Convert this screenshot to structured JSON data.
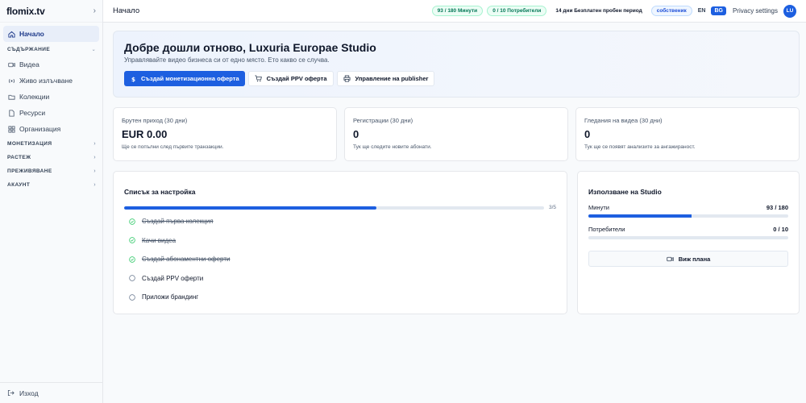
{
  "brand": {
    "logo": "flomix.tv",
    "collapse_icon": "chevron-right-icon"
  },
  "sidebar": {
    "items": [
      {
        "label": "Начало",
        "icon": "home-icon",
        "active": true
      }
    ],
    "sections": [
      {
        "label": "СЪДЪРЖАНИЕ",
        "open": true,
        "items": [
          {
            "label": "Видеа",
            "icon": "video-icon"
          },
          {
            "label": "Живо излъчване",
            "icon": "broadcast-icon"
          },
          {
            "label": "Колекции",
            "icon": "folder-icon"
          },
          {
            "label": "Ресурси",
            "icon": "file-icon"
          },
          {
            "label": "Организация",
            "icon": "grid-icon"
          }
        ]
      },
      {
        "label": "МОНЕТИЗАЦИЯ",
        "open": false
      },
      {
        "label": "РАСТЕЖ",
        "open": false
      },
      {
        "label": "ПРЕЖИВЯВАНЕ",
        "open": false
      },
      {
        "label": "АКАУНТ",
        "open": false
      }
    ],
    "logout": "Изход"
  },
  "topbar": {
    "title": "Начало",
    "minutes_badge": "93 / 180 Минути",
    "users_badge": "0 / 10 Потребители",
    "trial": "14 дни Безплатен пробен период",
    "role": "собственик",
    "lang_en": "EN",
    "lang_bg": "BG",
    "privacy": "Privacy settings",
    "avatar": "LU"
  },
  "hero": {
    "title": "Добре дошли отново, Luxuria Europae Studio",
    "subtitle": "Управлявайте видео бизнеса си от едно място. Ето какво се случва.",
    "buttons": [
      {
        "label": "Създай монетизационна оферта",
        "icon": "dollar-icon",
        "primary": true
      },
      {
        "label": "Създай PPV оферта",
        "icon": "cart-icon",
        "primary": false
      },
      {
        "label": "Управление на publisher",
        "icon": "printer-icon",
        "primary": false
      }
    ]
  },
  "stats": [
    {
      "label": "Брутен приход (30 дни)",
      "value": "EUR 0.00",
      "sub": "Ще се попълни след първите транзакции."
    },
    {
      "label": "Регистрации (30 дни)",
      "value": "0",
      "sub": "Тук ще следите новите абонати."
    },
    {
      "label": "Гледания на видеа (30 дни)",
      "value": "0",
      "sub": "Тук ще се появят анализите за ангажираност."
    }
  ],
  "checklist": {
    "title": "Списък за настройка",
    "progress_text": "3/5",
    "progress": 0.6,
    "tasks": [
      {
        "label": "Създай първа колекция",
        "done": true
      },
      {
        "label": "Качи видеа",
        "done": true
      },
      {
        "label": "Създай абонаментни оферти",
        "done": true
      },
      {
        "label": "Създай PPV оферти",
        "done": false
      },
      {
        "label": "Приложи брандинг",
        "done": false
      }
    ]
  },
  "usage": {
    "title": "Използване на Studio",
    "rows": [
      {
        "label": "Минути",
        "value": "93 / 180",
        "fraction": 0.517
      },
      {
        "label": "Потребители",
        "value": "0 / 10",
        "fraction": 0
      }
    ],
    "plan_button": "Виж плана",
    "plan_icon": "video-icon"
  },
  "colors": {
    "accent": "#1d5fe0",
    "success": "#22c55e",
    "badge_green": "#047857"
  }
}
